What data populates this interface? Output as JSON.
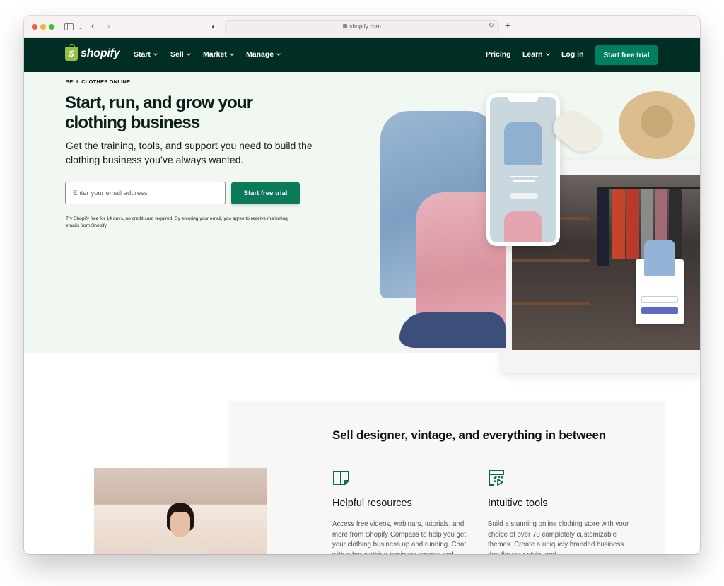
{
  "browser": {
    "url": "shopify.com",
    "icons": [
      "close-dot",
      "minimize-dot",
      "maximize-dot",
      "sidebar-icon",
      "chevron-down-icon",
      "back-icon",
      "forward-icon",
      "shield-icon",
      "lock-icon",
      "reload-icon",
      "new-tab-icon"
    ]
  },
  "nav": {
    "logo_text": "shopify",
    "left_items": [
      {
        "label": "Start",
        "has_dropdown": true
      },
      {
        "label": "Sell",
        "has_dropdown": true
      },
      {
        "label": "Market",
        "has_dropdown": true
      },
      {
        "label": "Manage",
        "has_dropdown": true
      }
    ],
    "right_items": [
      {
        "label": "Pricing",
        "has_dropdown": false
      },
      {
        "label": "Learn",
        "has_dropdown": true
      },
      {
        "label": "Log in",
        "has_dropdown": false
      }
    ],
    "cta_label": "Start free trial"
  },
  "hero": {
    "eyebrow": "SELL CLOTHES ONLINE",
    "title": "Start, run, and grow your clothing business",
    "subtitle": "Get the training, tools, and support you need to build the clothing business you’ve always wanted.",
    "email_placeholder": "Enter your email address",
    "email_value": "",
    "cta_label": "Start free trial",
    "fine_print": "Try Shopify free for 14 days, no credit card required. By entering your email, you agree to receive marketing emails from Shopify."
  },
  "section2": {
    "title": "Sell designer, vintage, and everything in between",
    "features": [
      {
        "icon": "book-icon",
        "title": "Helpful resources",
        "body": "Access free videos, webinars, tutorials, and more from Shopify Compass to help you get your clothing business up and running. Chat with other clothing business owners and"
      },
      {
        "icon": "theme-editor-icon",
        "title": "Intuitive tools",
        "body": "Build a stunning online clothing store with your choice of over 70 completely customizable themes. Create a uniquely branded business that fits your style, and"
      }
    ]
  },
  "colors": {
    "nav_bg": "#002e25",
    "cta_green": "#008060",
    "hero_bg": "#f1f8f1",
    "logo_green": "#95bf47",
    "panel_bg": "#f8f7f5"
  }
}
